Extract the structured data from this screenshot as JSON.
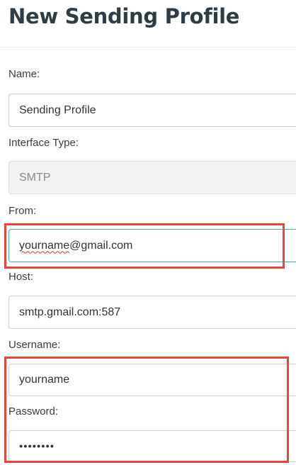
{
  "title": "New Sending Profile",
  "fields": {
    "name": {
      "label": "Name:",
      "value": "Sending Profile"
    },
    "interface_type": {
      "label": "Interface Type:",
      "value": "SMTP"
    },
    "from": {
      "label": "From:",
      "value_local": "yourname",
      "value_domain": "@gmail.com"
    },
    "host": {
      "label": "Host:",
      "value": "smtp.gmail.com:587"
    },
    "username": {
      "label": "Username:",
      "value": "yourname"
    },
    "password": {
      "label": "Password:",
      "value": "••••••••"
    }
  },
  "colors": {
    "title": "#2f3c46",
    "focus_border": "#37b4a0",
    "highlight": "#e8463a",
    "spellcheck": "#d9342b"
  }
}
